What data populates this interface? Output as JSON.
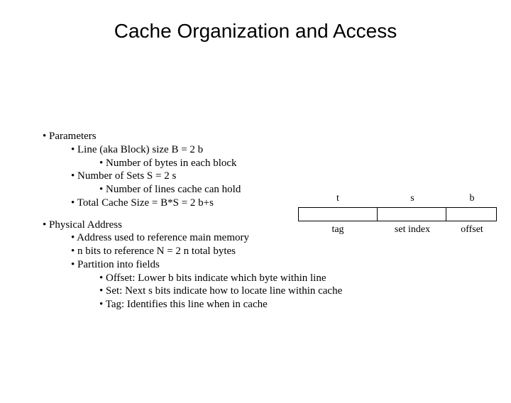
{
  "title": "Cache Organization and Access",
  "bullets": {
    "params": "• Parameters",
    "line_size": "• Line (aka Block) size B = 2 b",
    "num_bytes": "• Number of bytes in each block",
    "num_sets": "• Number of Sets S = 2 s",
    "num_lines": "• Number of lines cache can hold",
    "total_size": "• Total Cache Size = B*S = 2 b+s",
    "phys_addr": "• Physical Address",
    "addr_ref": "• Address used to reference main memory",
    "n_bits": "• n bits to reference N = 2 n total bytes",
    "partition": "• Partition into fields",
    "offset_desc": "• Offset: Lower b bits indicate which byte within line",
    "set_desc": "• Set: Next s bits indicate how to locate line within cache",
    "tag_desc": "• Tag: Identifies this line when in cache"
  },
  "diagram": {
    "top_t": "t",
    "top_s": "s",
    "top_b": "b",
    "bot_tag": "tag",
    "bot_set": "set index",
    "bot_off": "offset"
  }
}
